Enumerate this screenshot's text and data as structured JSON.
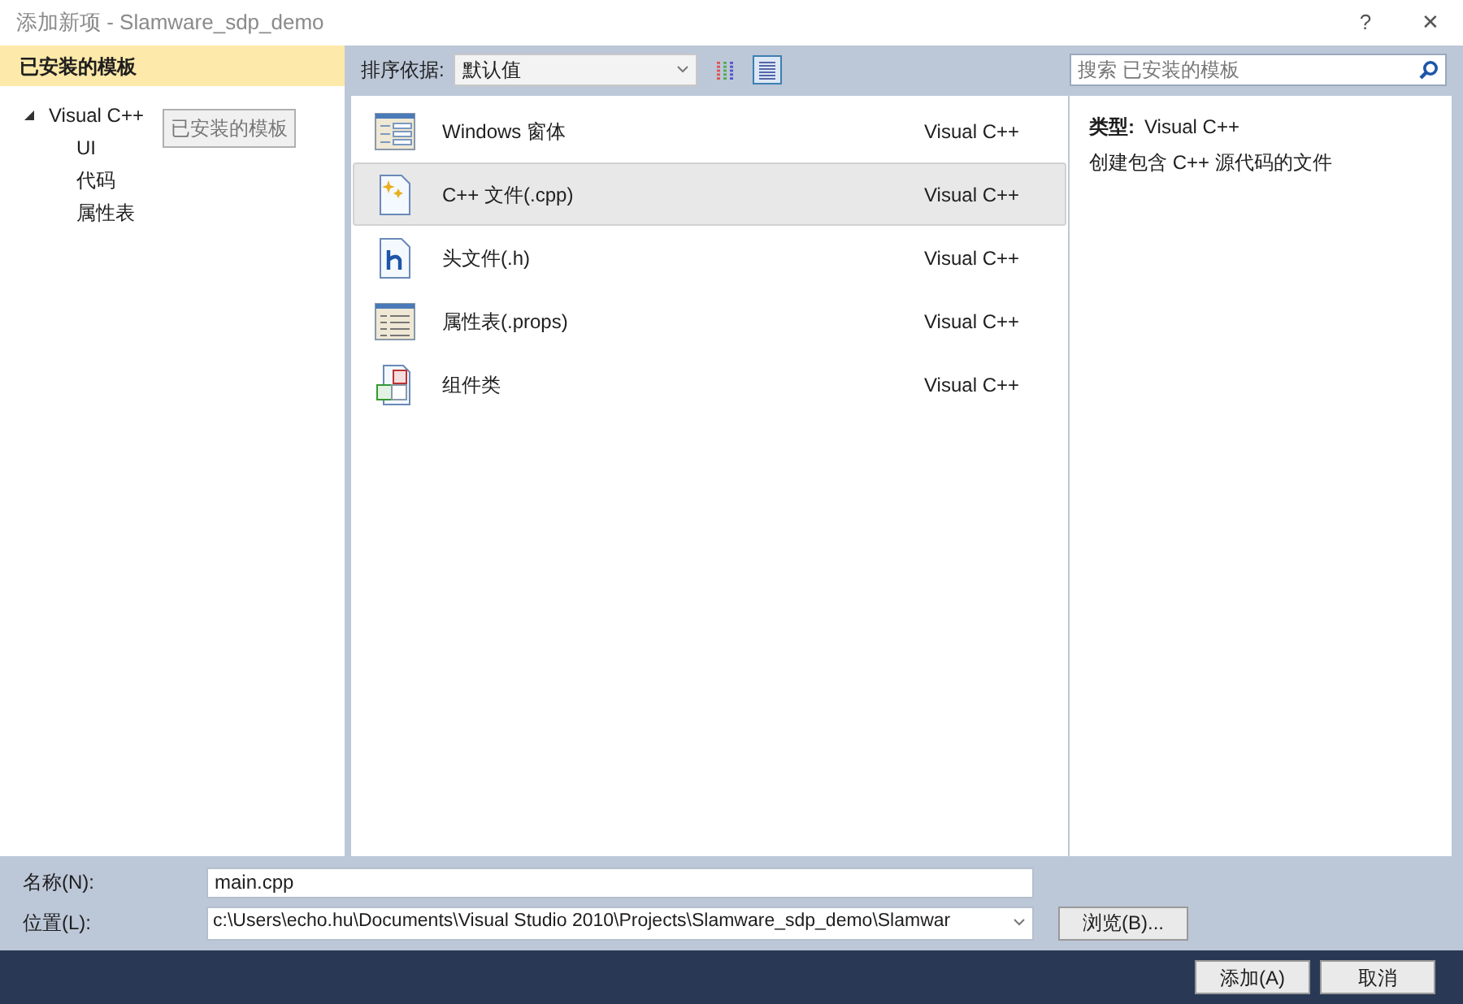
{
  "window": {
    "title": "添加新项 - Slamware_sdp_demo",
    "help": "?",
    "close": "✕"
  },
  "sidebar": {
    "header": "已安装的模板",
    "tree": [
      {
        "label": "Visual C++",
        "expanded": true,
        "children": [
          {
            "label": "UI"
          },
          {
            "label": "代码"
          },
          {
            "label": "属性表"
          }
        ]
      }
    ],
    "tooltip": "已安装的模板"
  },
  "toolbar": {
    "sort_label": "排序依据:",
    "sort_value": "默认值",
    "views": [
      {
        "kind": "small",
        "selected": false
      },
      {
        "kind": "list",
        "selected": true
      }
    ]
  },
  "search": {
    "placeholder": "搜索 已安装的模板"
  },
  "templates": [
    {
      "kind": "form",
      "name": "Windows 窗体",
      "type": "Visual C++",
      "selected": false
    },
    {
      "kind": "cpp",
      "name": "C++ 文件(.cpp)",
      "type": "Visual C++",
      "selected": true
    },
    {
      "kind": "header",
      "name": "头文件(.h)",
      "type": "Visual C++",
      "selected": false
    },
    {
      "kind": "props",
      "name": "属性表(.props)",
      "type": "Visual C++",
      "selected": false
    },
    {
      "kind": "component",
      "name": "组件类",
      "type": "Visual C++",
      "selected": false
    }
  ],
  "details": {
    "type_label": "类型:",
    "type_value": "Visual C++",
    "description": "创建包含 C++ 源代码的文件"
  },
  "form": {
    "name_label": "名称(N):",
    "name_value": "main.cpp",
    "location_label": "位置(L):",
    "location_value": "c:\\Users\\echo.hu\\Documents\\Visual Studio 2010\\Projects\\Slamware_sdp_demo\\Slamwar",
    "browse": "浏览(B)..."
  },
  "buttons": [
    "添加(A)",
    "取消"
  ]
}
